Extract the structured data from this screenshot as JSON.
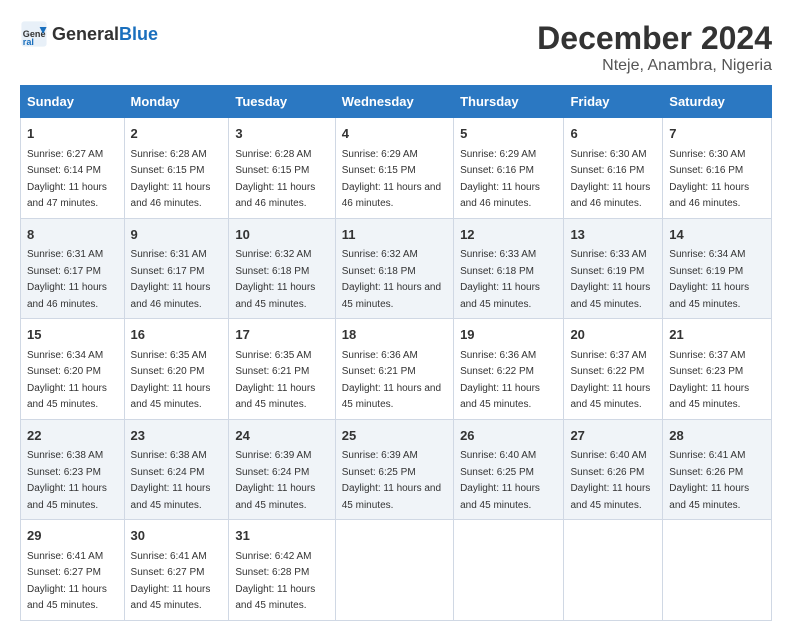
{
  "header": {
    "logo_general": "General",
    "logo_blue": "Blue",
    "title": "December 2024",
    "subtitle": "Nteje, Anambra, Nigeria"
  },
  "days_of_week": [
    "Sunday",
    "Monday",
    "Tuesday",
    "Wednesday",
    "Thursday",
    "Friday",
    "Saturday"
  ],
  "weeks": [
    [
      {
        "day": "1",
        "sunrise": "6:27 AM",
        "sunset": "6:14 PM",
        "daylight": "11 hours and 47 minutes."
      },
      {
        "day": "2",
        "sunrise": "6:28 AM",
        "sunset": "6:15 PM",
        "daylight": "11 hours and 46 minutes."
      },
      {
        "day": "3",
        "sunrise": "6:28 AM",
        "sunset": "6:15 PM",
        "daylight": "11 hours and 46 minutes."
      },
      {
        "day": "4",
        "sunrise": "6:29 AM",
        "sunset": "6:15 PM",
        "daylight": "11 hours and 46 minutes."
      },
      {
        "day": "5",
        "sunrise": "6:29 AM",
        "sunset": "6:16 PM",
        "daylight": "11 hours and 46 minutes."
      },
      {
        "day": "6",
        "sunrise": "6:30 AM",
        "sunset": "6:16 PM",
        "daylight": "11 hours and 46 minutes."
      },
      {
        "day": "7",
        "sunrise": "6:30 AM",
        "sunset": "6:16 PM",
        "daylight": "11 hours and 46 minutes."
      }
    ],
    [
      {
        "day": "8",
        "sunrise": "6:31 AM",
        "sunset": "6:17 PM",
        "daylight": "11 hours and 46 minutes."
      },
      {
        "day": "9",
        "sunrise": "6:31 AM",
        "sunset": "6:17 PM",
        "daylight": "11 hours and 46 minutes."
      },
      {
        "day": "10",
        "sunrise": "6:32 AM",
        "sunset": "6:18 PM",
        "daylight": "11 hours and 45 minutes."
      },
      {
        "day": "11",
        "sunrise": "6:32 AM",
        "sunset": "6:18 PM",
        "daylight": "11 hours and 45 minutes."
      },
      {
        "day": "12",
        "sunrise": "6:33 AM",
        "sunset": "6:18 PM",
        "daylight": "11 hours and 45 minutes."
      },
      {
        "day": "13",
        "sunrise": "6:33 AM",
        "sunset": "6:19 PM",
        "daylight": "11 hours and 45 minutes."
      },
      {
        "day": "14",
        "sunrise": "6:34 AM",
        "sunset": "6:19 PM",
        "daylight": "11 hours and 45 minutes."
      }
    ],
    [
      {
        "day": "15",
        "sunrise": "6:34 AM",
        "sunset": "6:20 PM",
        "daylight": "11 hours and 45 minutes."
      },
      {
        "day": "16",
        "sunrise": "6:35 AM",
        "sunset": "6:20 PM",
        "daylight": "11 hours and 45 minutes."
      },
      {
        "day": "17",
        "sunrise": "6:35 AM",
        "sunset": "6:21 PM",
        "daylight": "11 hours and 45 minutes."
      },
      {
        "day": "18",
        "sunrise": "6:36 AM",
        "sunset": "6:21 PM",
        "daylight": "11 hours and 45 minutes."
      },
      {
        "day": "19",
        "sunrise": "6:36 AM",
        "sunset": "6:22 PM",
        "daylight": "11 hours and 45 minutes."
      },
      {
        "day": "20",
        "sunrise": "6:37 AM",
        "sunset": "6:22 PM",
        "daylight": "11 hours and 45 minutes."
      },
      {
        "day": "21",
        "sunrise": "6:37 AM",
        "sunset": "6:23 PM",
        "daylight": "11 hours and 45 minutes."
      }
    ],
    [
      {
        "day": "22",
        "sunrise": "6:38 AM",
        "sunset": "6:23 PM",
        "daylight": "11 hours and 45 minutes."
      },
      {
        "day": "23",
        "sunrise": "6:38 AM",
        "sunset": "6:24 PM",
        "daylight": "11 hours and 45 minutes."
      },
      {
        "day": "24",
        "sunrise": "6:39 AM",
        "sunset": "6:24 PM",
        "daylight": "11 hours and 45 minutes."
      },
      {
        "day": "25",
        "sunrise": "6:39 AM",
        "sunset": "6:25 PM",
        "daylight": "11 hours and 45 minutes."
      },
      {
        "day": "26",
        "sunrise": "6:40 AM",
        "sunset": "6:25 PM",
        "daylight": "11 hours and 45 minutes."
      },
      {
        "day": "27",
        "sunrise": "6:40 AM",
        "sunset": "6:26 PM",
        "daylight": "11 hours and 45 minutes."
      },
      {
        "day": "28",
        "sunrise": "6:41 AM",
        "sunset": "6:26 PM",
        "daylight": "11 hours and 45 minutes."
      }
    ],
    [
      {
        "day": "29",
        "sunrise": "6:41 AM",
        "sunset": "6:27 PM",
        "daylight": "11 hours and 45 minutes."
      },
      {
        "day": "30",
        "sunrise": "6:41 AM",
        "sunset": "6:27 PM",
        "daylight": "11 hours and 45 minutes."
      },
      {
        "day": "31",
        "sunrise": "6:42 AM",
        "sunset": "6:28 PM",
        "daylight": "11 hours and 45 minutes."
      },
      null,
      null,
      null,
      null
    ]
  ]
}
